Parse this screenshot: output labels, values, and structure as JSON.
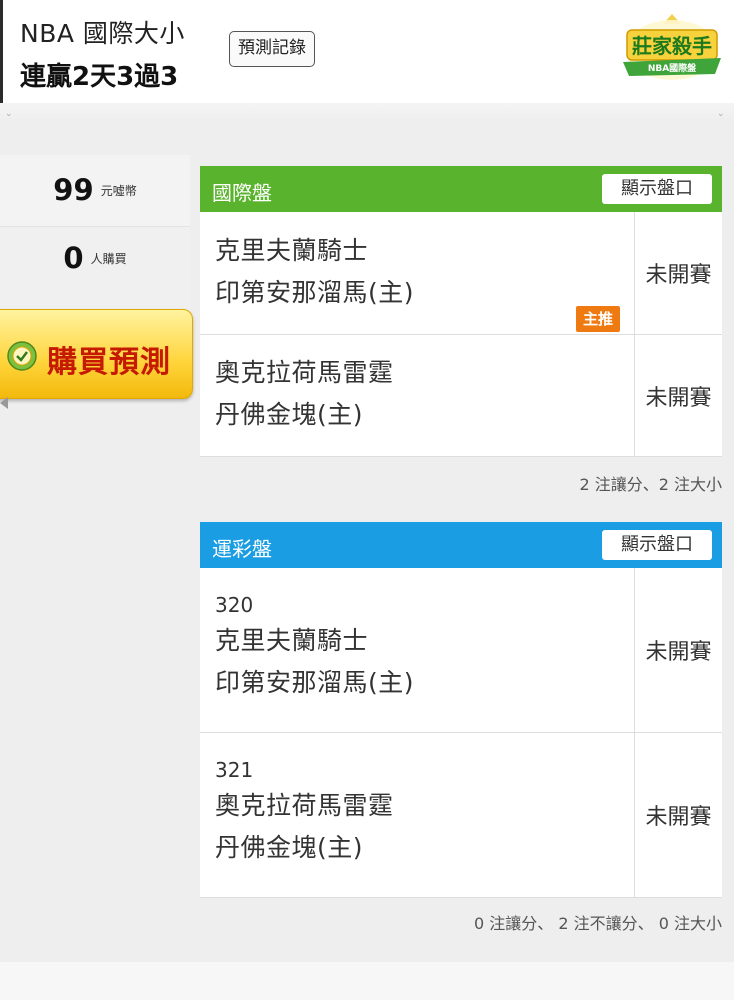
{
  "header": {
    "title_line1": "NBA 國際大小",
    "title_line2": "連贏2天3過3",
    "record_button": "預測記錄",
    "brand_logo_text": "莊家殺手",
    "brand_logo_sub": "NBA國際盤"
  },
  "sidebar": {
    "price_value": "99",
    "price_unit": "元噓幣",
    "buyers_value": "0",
    "buyers_unit": "人購買",
    "buy_button": "購買預測"
  },
  "international": {
    "title": "國際盤",
    "toggle": "顯示盤口",
    "color": "#5ab32d",
    "games": [
      {
        "away": "克里夫蘭騎士",
        "home": "印第安那溜馬(主)",
        "status": "未開賽",
        "tag": "主推"
      },
      {
        "away": "奧克拉荷馬雷霆",
        "home": "丹佛金塊(主)",
        "status": "未開賽"
      }
    ],
    "summary": "2 注讓分、2 注大小"
  },
  "sports_lottery": {
    "title": "運彩盤",
    "toggle": "顯示盤口",
    "color": "#1a9de3",
    "games": [
      {
        "code": "320",
        "away": "克里夫蘭騎士",
        "home": "印第安那溜馬(主)",
        "status": "未開賽"
      },
      {
        "code": "321",
        "away": "奧克拉荷馬雷霆",
        "home": "丹佛金塊(主)",
        "status": "未開賽"
      }
    ],
    "summary": "0 注讓分、 2 注不讓分、 0 注大小"
  }
}
